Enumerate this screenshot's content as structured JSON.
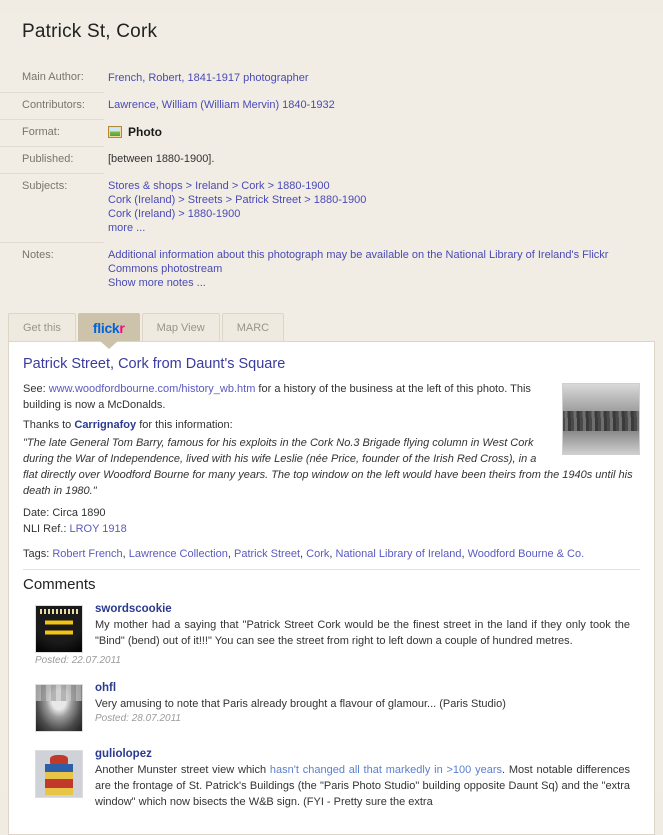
{
  "record": {
    "title": "Patrick St, Cork",
    "fields": [
      {
        "label": "Main Author:",
        "type": "links",
        "lines": [
          "French, Robert, 1841-1917 photographer"
        ]
      },
      {
        "label": "Contributors:",
        "type": "links",
        "lines": [
          "Lawrence, William (William Mervin) 1840-1932"
        ]
      },
      {
        "label": "Format:",
        "type": "format",
        "value": "Photo",
        "icon": "photo-icon"
      },
      {
        "label": "Published:",
        "type": "plain",
        "lines": [
          "[between 1880-1900]."
        ]
      },
      {
        "label": "Subjects:",
        "type": "links",
        "lines": [
          "Stores & shops > Ireland > Cork > 1880-1900",
          "Cork (Ireland) > Streets > Patrick Street > 1880-1900",
          "Cork (Ireland) > 1880-1900",
          "more ..."
        ]
      },
      {
        "label": "Notes:",
        "type": "links",
        "lines": [
          "Additional information about this photograph may be available on the National Library of Ireland's Flickr Commons photostream",
          "Show more notes ..."
        ]
      }
    ]
  },
  "tabs": [
    {
      "label": "Get this",
      "name": "tab-get-this",
      "active": false
    },
    {
      "label": "flickr",
      "name": "tab-flickr",
      "active": true,
      "logo": true
    },
    {
      "label": "Map View",
      "name": "tab-map-view",
      "active": false
    },
    {
      "label": "MARC",
      "name": "tab-marc",
      "active": false
    }
  ],
  "flickr": {
    "heading": "Patrick Street, Cork from Daunt's Square",
    "see_prefix": "See:",
    "see_link": "www.woodfordbourne.com/history_wb.htm",
    "see_suffix": "for a history of the business at the left of this photo. This building is now a McDonalds.",
    "thanks_prefix": "Thanks to",
    "thanks_user": "Carrignafoy",
    "thanks_suffix": "for this information:",
    "quote": "\"The late General Tom Barry, famous for his exploits in the Cork No.3 Brigade flying column in West Cork during the War of Independence, lived with his wife Leslie (née Price, founder of the Irish Red Cross), in a flat directly over Woodford Bourne for many years. The top window on the left would have been theirs from the 1940s until his death in 1980.\"",
    "date_label": "Date:",
    "date_value": "Circa 1890",
    "nli_label": "NLI Ref.:",
    "nli_value": "LROY 1918",
    "tags_label": "Tags:",
    "tags": [
      "Robert French",
      "Lawrence Collection",
      "Patrick Street",
      "Cork",
      "National Library of Ireland",
      "Woodford Bourne & Co."
    ],
    "thumbnail_alt": "historic black and white street photograph of Patrick Street Cork",
    "comments_heading": "Comments",
    "comments": [
      {
        "user": "swordscookie",
        "avatar": "young-munster-rfc-crest-avatar",
        "text": "My mother had a saying that \"Patrick Street Cork would be the finest street in the land if they only took the \"Bind\" (bend) out of it!!!\" You can see the street from right to left down a couple of hundred metres.",
        "posted": "Posted: 22.07.2011"
      },
      {
        "user": "ohfl",
        "avatar": "man-portrait-avatar",
        "text": "Very amusing to note that Paris already brought a flavour of glamour... (Paris Studio)",
        "posted": "Posted: 28.07.2011"
      },
      {
        "user": "guliolopez",
        "avatar": "action-figure-avatar",
        "text_before": "Another Munster street view which ",
        "text_link": "hasn't changed all that markedly in >100 years",
        "text_after": ". Most notable differences are the frontage of St. Patrick's Buildings (the \"Paris Photo Studio\" building opposite Daunt Sq) and the \"extra window\" which now bisects the W&B sign. (FYI - Pretty sure the extra",
        "posted": ""
      }
    ]
  },
  "colors": {
    "page_bg": "#f1ede4",
    "link": "#4a4ab5",
    "tab_active_bg": "#cdc3ab",
    "flickr_blue": "#0063dc",
    "flickr_pink": "#ff0084",
    "heading": "#3b3b9e",
    "label_gray": "#7a756b"
  }
}
